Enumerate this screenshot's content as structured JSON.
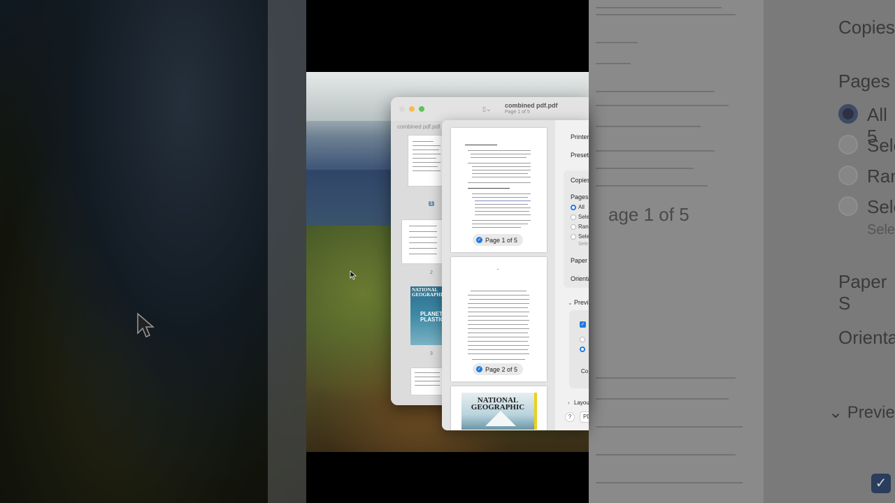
{
  "preview_window": {
    "title": "combined pdf.pdf",
    "subtitle": "Page 1 of 5",
    "sidebar_label": "combined pdf.pdf",
    "thumbnails": [
      {
        "number": "1",
        "selected": true
      },
      {
        "number": "2",
        "selected": false
      },
      {
        "number": "3",
        "selected": false
      }
    ],
    "cover_title": "NATIONAL GEOGRAPHIC",
    "cover_subtitle": "PLANET PLASTIC"
  },
  "print_dialog": {
    "pages_preview": [
      {
        "badge": "Page 1 of 5",
        "checked": true
      },
      {
        "badge": "Page 2 of 5",
        "checked": true
      }
    ],
    "cover_title": "NATIONAL GEOGRAPHIC",
    "settings": {
      "printer_label": "Printer",
      "presets_label": "Presets",
      "copies_label": "Copies",
      "pages_label": "Pages",
      "pages_options": [
        "All",
        "Sele",
        "Ran",
        "Sele"
      ],
      "pages_option_sub": "Sele",
      "paper_size_label": "Paper S",
      "orientation_label": "Orienta",
      "preview_section_label": "Previe",
      "co_label": "Co",
      "layout_label": "Layou",
      "help_label": "?",
      "pdf_label": "PD"
    }
  },
  "background_right": {
    "copies": "Copies",
    "pages": "Pages",
    "page_indicator": "age 1 of 5",
    "options": [
      "All 5",
      "Sele",
      "Ran",
      "Sele"
    ],
    "option_sub": "Sele",
    "paper_size": "Paper S",
    "orientation": "Orienta",
    "preview": "Previe"
  },
  "colors": {
    "accent": "#1f7ae0",
    "traffic_yellow": "#f5bd4f",
    "traffic_green": "#5bc45a"
  }
}
